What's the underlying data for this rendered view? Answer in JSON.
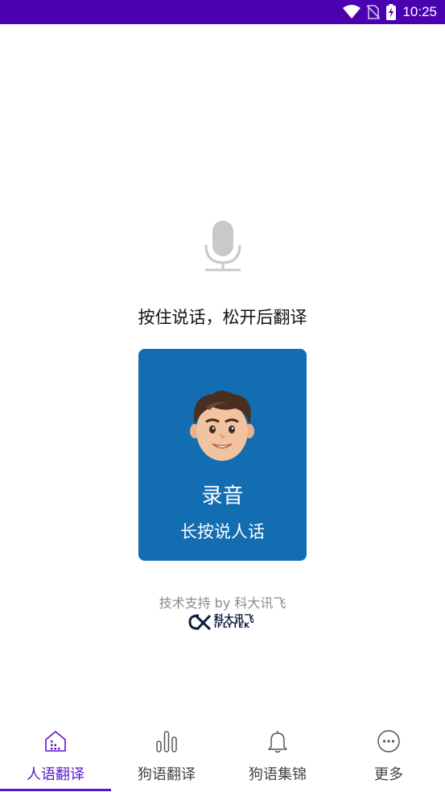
{
  "status_bar": {
    "time": "10:25",
    "background": "#4a02b0"
  },
  "main": {
    "hint": "按住说话，松开后翻译",
    "record_card": {
      "title": "录音",
      "subtitle": "长按说人话",
      "color": "#136db1"
    }
  },
  "footer": {
    "powered_by": "技术支持 by 科大讯飞",
    "logo_cn": "科大讯飞",
    "logo_en": "iFLYTEK"
  },
  "tabs": [
    {
      "label": "人语翻译",
      "icon": "house-icon",
      "active": true
    },
    {
      "label": "狗语翻译",
      "icon": "bars-icon",
      "active": false
    },
    {
      "label": "狗语集锦",
      "icon": "bell-icon",
      "active": false
    },
    {
      "label": "更多",
      "icon": "more-icon",
      "active": false
    }
  ],
  "accent_color": "#5b17c8"
}
